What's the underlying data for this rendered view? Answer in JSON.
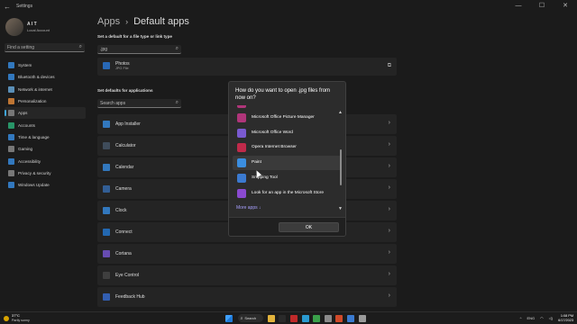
{
  "window": {
    "back": "←",
    "title": "Settings",
    "min": "—",
    "max": "☐",
    "close": "✕"
  },
  "sidebar": {
    "user_name": "A I T",
    "user_sub": "Local Account",
    "search_placeholder": "Find a setting",
    "items": [
      {
        "label": "System",
        "color": "#3b8ee0",
        "icon": "system-icon"
      },
      {
        "label": "Bluetooth & devices",
        "color": "#3b8ee0",
        "icon": "bluetooth-icon"
      },
      {
        "label": "Network & internet",
        "color": "#6aa9d8",
        "icon": "network-icon"
      },
      {
        "label": "Personalization",
        "color": "#e08a3c",
        "icon": "brush-icon"
      },
      {
        "label": "Apps",
        "color": "#8c8c8c",
        "icon": "apps-icon"
      },
      {
        "label": "Accounts",
        "color": "#2fb07a",
        "icon": "accounts-icon"
      },
      {
        "label": "Time & language",
        "color": "#3b8ee0",
        "icon": "globe-icon"
      },
      {
        "label": "Gaming",
        "color": "#8c8c8c",
        "icon": "gaming-icon"
      },
      {
        "label": "Accessibility",
        "color": "#3b8ee0",
        "icon": "accessibility-icon"
      },
      {
        "label": "Privacy & security",
        "color": "#8c8c8c",
        "icon": "shield-icon"
      },
      {
        "label": "Windows Update",
        "color": "#3b8ee0",
        "icon": "update-icon"
      }
    ],
    "active_index": 4
  },
  "main": {
    "breadcrumb_parent": "Apps",
    "breadcrumb_sep": "›",
    "breadcrumb_current": "Default apps",
    "filetype_label": "Set a default for a file type or link type",
    "filetype_value": ".jpg",
    "photos_name": "Photos",
    "photos_sub": "JPG File",
    "apps_label": "Set defaults for applications",
    "apps_search_placeholder": "Search apps",
    "apps": [
      {
        "name": "App Installer",
        "color": "#3b8ee0"
      },
      {
        "name": "Calculator",
        "color": "#4a5a6a"
      },
      {
        "name": "Calendar",
        "color": "#3b8ee0"
      },
      {
        "name": "Camera",
        "color": "#3b6fb0"
      },
      {
        "name": "Clock",
        "color": "#3b8ee0"
      },
      {
        "name": "Connect",
        "color": "#2a7bd0"
      },
      {
        "name": "Cortana",
        "color": "#7a5ad0"
      },
      {
        "name": "Eye Control",
        "color": "#4a4a4a"
      },
      {
        "name": "Feedback Hub",
        "color": "#3b6fd0"
      }
    ]
  },
  "dialog": {
    "title": "How do you want to open .jpg files from now on?",
    "items": [
      {
        "label": "Microsoft Office Picture Manager",
        "color": "#b0357a",
        "icon": "picture-manager-icon"
      },
      {
        "label": "Microsoft Office Word",
        "color": "#7a5ad0",
        "icon": "word-icon"
      },
      {
        "label": "Opera Internet Browser",
        "color": "#c02a4a",
        "icon": "opera-icon"
      },
      {
        "label": "Paint",
        "color": "#3b8ee0",
        "icon": "paint-icon"
      },
      {
        "label": "Snipping Tool",
        "color": "#3b7ad0",
        "icon": "snipping-tool-icon"
      },
      {
        "label": "Look for an app in the Microsoft Store",
        "color": "#8a4ad0",
        "icon": "store-icon"
      }
    ],
    "selected_index": 3,
    "more_apps": "More apps ↓",
    "ok": "OK"
  },
  "taskbar": {
    "temp": "37°C",
    "weather": "Partly sunny",
    "search": "Search",
    "lang": "ENG",
    "time": "1:08 PM",
    "date": "6/17/2023",
    "pinned": [
      {
        "name": "file-explorer-icon",
        "color": "#e2b33c"
      },
      {
        "name": "media-icon",
        "color": "#2a2a2a"
      },
      {
        "name": "opera-taskbar-icon",
        "color": "#c02a2a"
      },
      {
        "name": "edge-icon",
        "color": "#2a9ad0"
      },
      {
        "name": "chrome-icon",
        "color": "#3aa04a"
      },
      {
        "name": "app-icon",
        "color": "#8a8a8a"
      },
      {
        "name": "powerpoint-icon",
        "color": "#d04a2a"
      },
      {
        "name": "paint-taskbar-icon",
        "color": "#3a7ad0"
      },
      {
        "name": "settings-taskbar-icon",
        "color": "#9a9a9a"
      }
    ]
  }
}
